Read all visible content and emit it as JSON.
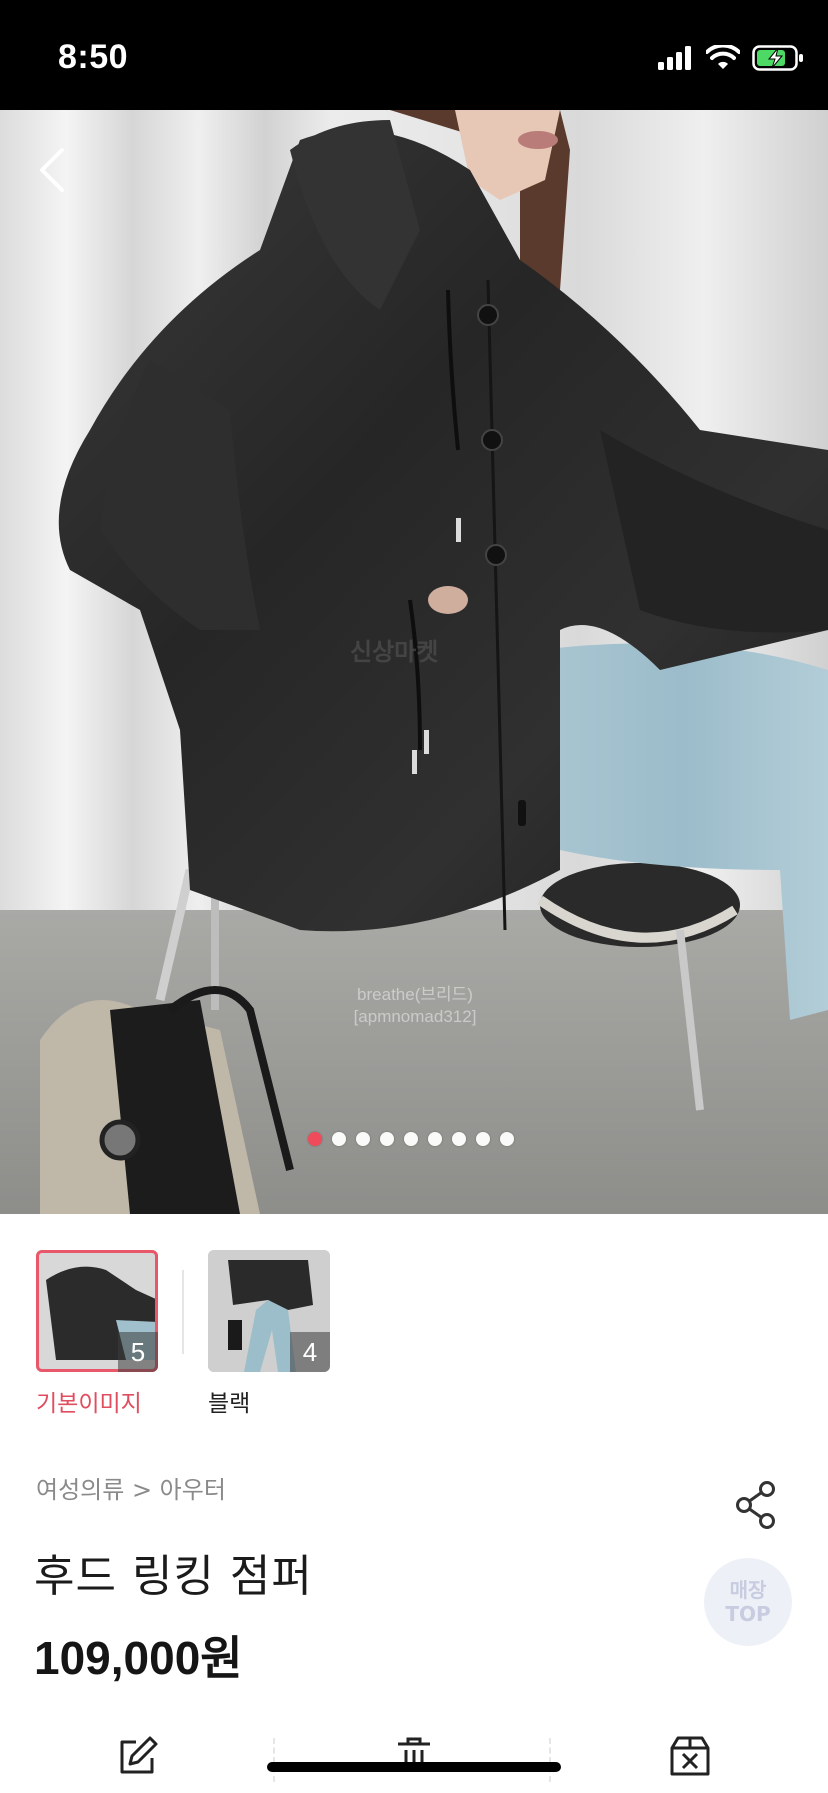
{
  "status_bar": {
    "time": "8:50"
  },
  "hero": {
    "watermark_center": "신상마켓",
    "watermark_seller_line1": "breathe(브리드)",
    "watermark_seller_line2": "[apmnomad312]",
    "dot_count": 9,
    "active_dot": 0
  },
  "thumbnails": [
    {
      "label": "기본이미지",
      "count": "5",
      "selected": true
    },
    {
      "label": "블랙",
      "count": "4",
      "selected": false
    }
  ],
  "product": {
    "breadcrumb": "여성의류 > 아우터",
    "title": "후드 링킹 점퍼",
    "price": "109,000",
    "price_unit": "원"
  },
  "top_button": {
    "line1": "매장",
    "line2": "TOP"
  },
  "colors": {
    "accent": "#e9586a",
    "active_dot": "#f04b5a",
    "top_button_bg": "#eef0f7"
  },
  "icons": [
    "back-chevron-icon",
    "share-icon",
    "edit-icon",
    "trash-icon",
    "remove-box-icon"
  ]
}
